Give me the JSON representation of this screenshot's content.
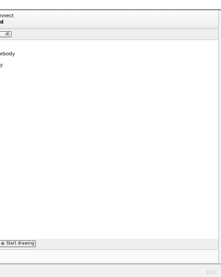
{
  "header": {
    "title_line1": "nnect",
    "title_line2": "d"
  },
  "toolbar": {
    "button_label": "d)"
  },
  "main": {
    "line1": "ebody",
    "line2": "y"
  },
  "bottom": {
    "start_drawing_label": "Start drawing",
    "start_drawing_icon": "move-cross-icon"
  }
}
